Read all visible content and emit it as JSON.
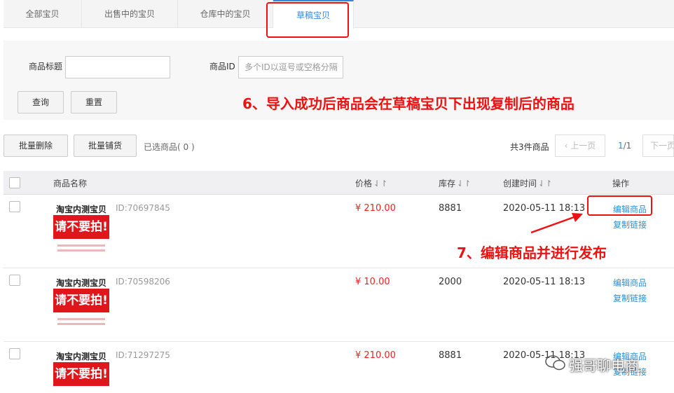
{
  "tabs": [
    "全部宝贝",
    "出售中的宝贝",
    "仓库中的宝贝",
    "草稿宝贝"
  ],
  "filter": {
    "title_label": "商品标题",
    "title_value": "",
    "id_label": "商品ID",
    "id_placeholder": "多个ID以逗号或空格分隔",
    "query_button": "查询",
    "reset_button": "重置"
  },
  "toolbar": {
    "batch_delete": "批量删除",
    "batch_list": "批量铺货",
    "selected": "已选商品( 0 )",
    "total": "共3件商品",
    "prev": "上一页",
    "page_current": "1",
    "page_total": "/1",
    "next": "下一页"
  },
  "table": {
    "columns": {
      "name": "商品名称",
      "price": "价格",
      "stock": "库存",
      "created": "创建时间",
      "action": "操作"
    },
    "sort_glyph": "⇃↾",
    "thumb_text": "请不要拍!",
    "rows": [
      {
        "name": "淘宝内测宝贝",
        "id": "ID:70697845",
        "price": "¥ 210.00",
        "stock": "8881",
        "created": "2020-05-11 18:13",
        "edit": "编辑商品",
        "copy": "复制链接"
      },
      {
        "name": "淘宝内测宝贝",
        "id": "ID:70598206",
        "price": "¥ 10.00",
        "stock": "2000",
        "created": "2020-05-11 18:13",
        "edit": "编辑商品",
        "copy": "复制链接"
      },
      {
        "name": "淘宝内测宝贝",
        "id": "ID:71297275",
        "price": "¥ 210.00",
        "stock": "8881",
        "created": "2020-05-11 18:13",
        "edit": "编辑商品",
        "copy": "复制链接"
      }
    ]
  },
  "annotations": {
    "step6": "6、导入成功后商品会在草稿宝贝下出现复制后的商品",
    "step7": "7、编辑商品并进行发布",
    "color": "#e11111"
  },
  "watermark": "强哥聊电商",
  "colors": {
    "accent": "#3089dc",
    "price": "#e22222",
    "link": "#2a8fd6"
  }
}
